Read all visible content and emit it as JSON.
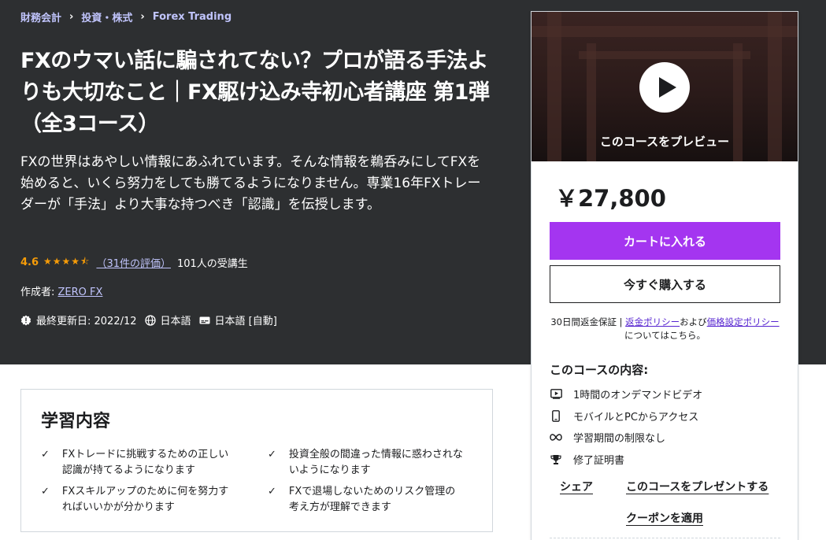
{
  "breadcrumb": [
    "財務会計",
    "投資・株式",
    "Forex Trading"
  ],
  "course": {
    "title": "FXのウマい話に騙されてない？プロが語る手法よりも大切なこと｜FX駆け込み寺初心者講座 第1弾（全3コース）",
    "subtitle": "FXの世界はあやしい情報にあふれています。そんな情報を鵜呑みにしてFXを始めると、いくら努力をしても勝てるようになりません。専業16年FXトレーダーが「手法」より大事な持つべき「認識」を伝授します。",
    "rating": "4.6",
    "rating_count": "（31件の評価）",
    "students": "101人の受講生",
    "author_label": "作成者:",
    "author": "ZERO FX",
    "updated": "最終更新日: 2022/12",
    "language": "日本語",
    "captions": "日本語 [自動]"
  },
  "learn": {
    "title": "学習内容",
    "items": [
      "FXトレードに挑戦するための正しい認識が持てるようになります",
      "投資全般の間違った情報に惑わされないようになります",
      "FXスキルアップのために何を努力すればいいかが分かります",
      "FXで退場しないためのリスク管理の考え方が理解できます"
    ]
  },
  "sidebar": {
    "preview_label": "このコースをプレビュー",
    "price": "￥27,800",
    "add_to_cart": "カートに入れる",
    "buy_now": "今すぐ購入する",
    "refund_prefix": "30日間返金保証 | ",
    "refund_link": "返金ポリシー",
    "refund_mid": "および",
    "pricing_link": "価格設定ポリシー",
    "refund_suffix": "についてはこちら。",
    "includes_title": "このコースの内容:",
    "includes": [
      {
        "icon": "video-icon",
        "text": "1時間のオンデマンドビデオ"
      },
      {
        "icon": "mobile-icon",
        "text": "モバイルとPCからアクセス"
      },
      {
        "icon": "infinity-icon",
        "text": "学習期間の制限なし"
      },
      {
        "icon": "trophy-icon",
        "text": "修了証明書"
      }
    ],
    "share": "シェア",
    "gift": "このコースをプレゼントする",
    "coupon": "クーポンを適用"
  },
  "colors": {
    "hero_bg": "#2d2f31",
    "accent_purple": "#a435f0",
    "link_lavender": "#c0c4fc",
    "star_orange": "#f69c08",
    "link_purple": "#5624d0"
  }
}
